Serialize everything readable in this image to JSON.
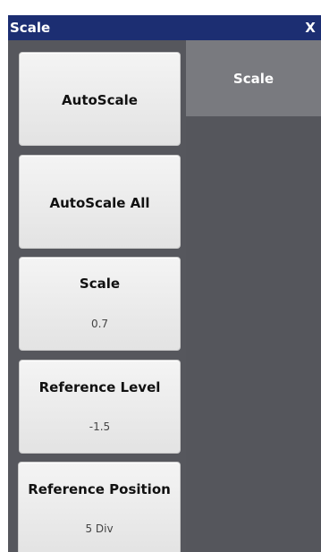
{
  "window": {
    "title": "Scale",
    "close_label": "X"
  },
  "softkeys": [
    {
      "label": "AutoScale",
      "value": ""
    },
    {
      "label": "AutoScale All",
      "value": ""
    },
    {
      "label": "Scale",
      "value": "0.7"
    },
    {
      "label": "Reference Level",
      "value": "-1.5"
    },
    {
      "label": "Reference Position",
      "value": "5 Div"
    }
  ],
  "tabs": [
    {
      "label": "Scale"
    }
  ],
  "colors": {
    "titlebar": "#1c2e72",
    "panel_background": "#56575d",
    "active_tab": "#797a7f",
    "softkey_face": "#ededed"
  }
}
